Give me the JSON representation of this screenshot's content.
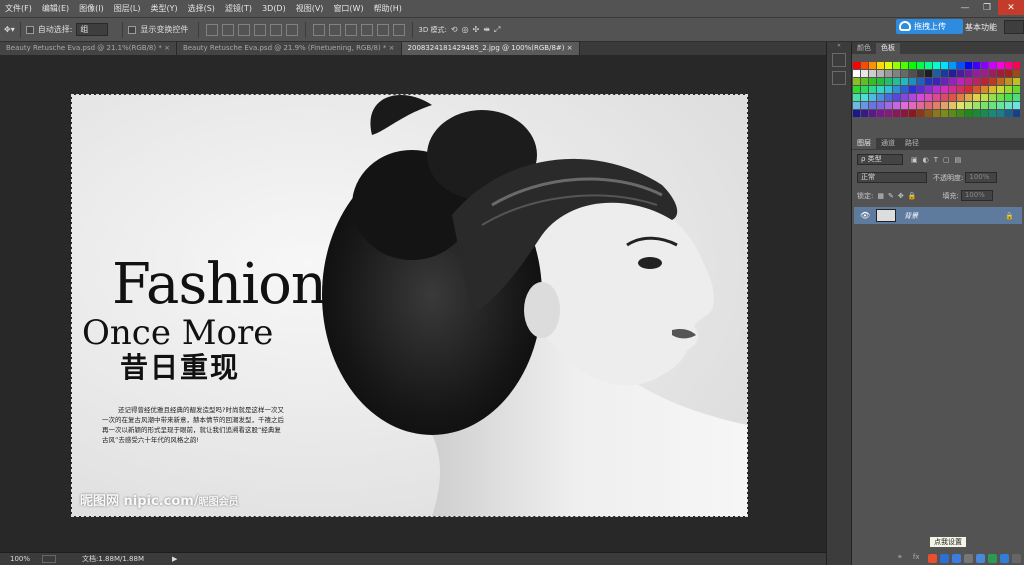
{
  "menu": [
    "文件(F)",
    "编辑(E)",
    "图像(I)",
    "图层(L)",
    "类型(Y)",
    "选择(S)",
    "滤镜(T)",
    "3D(D)",
    "视图(V)",
    "窗口(W)",
    "帮助(H)"
  ],
  "window_controls": {
    "minimize": "—",
    "maximize": "❐",
    "close": "✕"
  },
  "options": {
    "auto_select_label": "自动选择:",
    "auto_select_value": "组",
    "show_transform_label": "显示变换控件",
    "mode_3d_label": "3D 模式:"
  },
  "cloud_button": "拖拽上传",
  "workspace": "基本功能",
  "tabs": [
    {
      "label": "Beauty Retusche Eva.psd @ 21.1%(RGB/8) *",
      "close": "×"
    },
    {
      "label": "Beauty Retusche Eva.psd @ 21.9% (Finetuening, RGB/8) *",
      "close": "×"
    },
    {
      "label": "20083241814294​85_2.jpg @ 100%(RGB/8#)",
      "close": "×"
    }
  ],
  "document": {
    "title": "Fashion",
    "subtitle": "Once More",
    "subtitle_cn": "昔日重现",
    "body": [
      "还记得曾经优雅且经典的靓发造型吗?时尚就是这样一次又",
      "一次的在复古风潮中带来新意，赫本情节的回潮发型，千禧之后",
      "再一次以新颖的形式呈现于眼前，就让我们追溯看这股“经典复",
      "古风”去感受六十年代的风格之韵!"
    ],
    "watermark": "昵图网 nipic.com/",
    "watermark2": "昵图会员"
  },
  "status": {
    "zoom": "100%",
    "doc_info": "文档:1.88M/1.88M"
  },
  "panels": {
    "color_tabs": [
      "颜色",
      "色板"
    ],
    "layer_tabs": [
      "图层",
      "通道",
      "路径"
    ],
    "kind_label": "ρ 类型",
    "blend_mode": "正常",
    "opacity_label": "不透明度:",
    "opacity_value": "100%",
    "lock_label": "锁定:",
    "fill_label": "填充:",
    "fill_value": "100%",
    "layer_name": "背景"
  },
  "tooltip": "点我设置",
  "colors": {
    "accent": "#2d8be0",
    "selected_layer": "#5e7a9d"
  }
}
